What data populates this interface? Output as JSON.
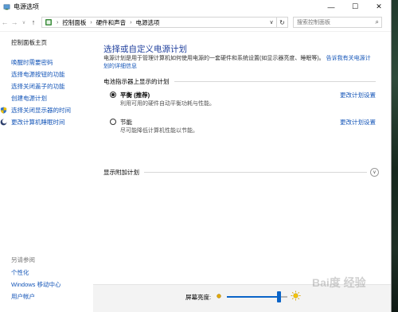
{
  "window": {
    "title": "电源选项",
    "controls": {
      "minimize": "—",
      "maximize": "☐",
      "close": "✕"
    }
  },
  "address": {
    "crumbs": [
      "控制面板",
      "硬件和声音",
      "电源选项"
    ],
    "search_placeholder": "搜索控制面板"
  },
  "leftnav": {
    "home": "控制面板主页",
    "links": [
      {
        "label": "唤醒时需要密码",
        "shield": false
      },
      {
        "label": "选择电源按钮的功能",
        "shield": false
      },
      {
        "label": "选择关闭盖子的功能",
        "shield": false
      },
      {
        "label": "创建电源计划",
        "shield": false
      },
      {
        "label": "选择关闭显示器的时间",
        "shield": true
      },
      {
        "label": "更改计算机睡眠时间",
        "shield": true
      }
    ],
    "see_also_title": "另请参阅",
    "see_also": [
      "个性化",
      "Windows 移动中心",
      "用户帐户"
    ]
  },
  "main": {
    "title": "选择或自定义电源计划",
    "description": "电源计划是用于管理计算机如何使用电源的一套硬件和系统设置(如显示器亮度、睡眠等)。",
    "description_link": "告诉我有关电源计划的详细信息",
    "section_title": "电池指示器上显示的计划",
    "plans": [
      {
        "name": "平衡 (推荐)",
        "description": "利用可用的硬件自动平衡功耗与性能。",
        "selected": true,
        "settings_link": "更改计划设置"
      },
      {
        "name": "节能",
        "description": "尽可能降低计算机性能以节能。",
        "selected": false,
        "settings_link": "更改计划设置"
      }
    ],
    "extra_plans": "显示附加计划"
  },
  "brightness": {
    "label": "屏幕亮度:",
    "level": 0.86,
    "accent": "#0a64c8"
  },
  "watermark": "Bai度 经验",
  "colors": {
    "link": "#1556b8",
    "title": "#1f3f9d",
    "accent": "#0a64c8"
  }
}
